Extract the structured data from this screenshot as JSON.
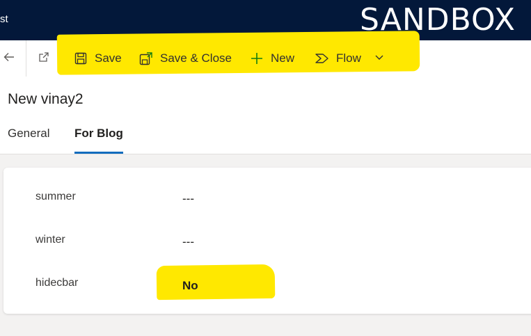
{
  "topbar": {
    "app_name_fragment": "st",
    "environment_label": "SANDBOX"
  },
  "commandbar": {
    "back_icon": "arrow-left-icon",
    "popout_icon": "open-in-new-window-icon",
    "items": [
      {
        "label": "Save",
        "icon": "save-icon"
      },
      {
        "label": "Save & Close",
        "icon": "save-close-icon"
      },
      {
        "label": "New",
        "icon": "plus-icon"
      },
      {
        "label": "Flow",
        "icon": "flow-icon"
      }
    ],
    "overflow_icon": "chevron-down-icon",
    "accent_color": "#107c10"
  },
  "header": {
    "title": "New vinay2",
    "tabs": [
      {
        "label": "General",
        "active": false
      },
      {
        "label": "For Blog",
        "active": true
      }
    ]
  },
  "form": {
    "fields": [
      {
        "label": "summer",
        "value": "---"
      },
      {
        "label": "winter",
        "value": "---"
      },
      {
        "label": "hidecbar",
        "value": "No"
      }
    ]
  },
  "highlight_color": "#ffe800",
  "topbar_color": "#03183a"
}
